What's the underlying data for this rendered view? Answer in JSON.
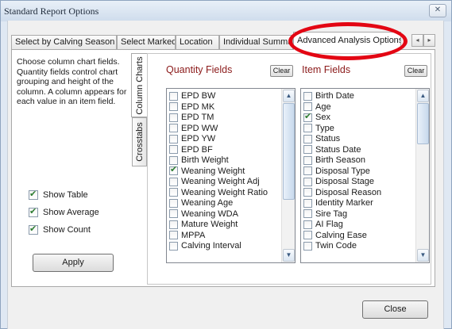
{
  "window": {
    "title": "Standard Report Options",
    "close_glyph": "✕"
  },
  "tabs": [
    {
      "label": "Select by Calving Season"
    },
    {
      "label": "Select Marked"
    },
    {
      "label": "Location"
    },
    {
      "label": "Individual Summary"
    },
    {
      "label": "Advanced Analysis Options",
      "active": true
    }
  ],
  "tab_scroll": {
    "left": "◂",
    "right": "▸"
  },
  "vertical_tabs": [
    {
      "label": "Column Charts",
      "active": true
    },
    {
      "label": "Crosstabs"
    }
  ],
  "description": "Choose column chart fields. Quantity fields control chart grouping and height of the column. A column appears for each value in an item field.",
  "options": [
    {
      "label": "Show Table",
      "checked": true
    },
    {
      "label": "Show Average",
      "checked": true
    },
    {
      "label": "Show Count",
      "checked": true
    }
  ],
  "apply_label": "Apply",
  "quantity_fields": {
    "title": "Quantity Fields",
    "clear_label": "Clear",
    "items": [
      {
        "label": "EPD BW",
        "checked": false
      },
      {
        "label": "EPD MK",
        "checked": false
      },
      {
        "label": "EPD TM",
        "checked": false
      },
      {
        "label": "EPD WW",
        "checked": false
      },
      {
        "label": "EPD YW",
        "checked": false
      },
      {
        "label": "EPD BF",
        "checked": false
      },
      {
        "label": "Birth Weight",
        "checked": false
      },
      {
        "label": "Weaning Weight",
        "checked": true
      },
      {
        "label": "Weaning Weight Adj",
        "checked": false
      },
      {
        "label": "Weaning Weight Ratio",
        "checked": false
      },
      {
        "label": "Weaning Age",
        "checked": false
      },
      {
        "label": "Weaning WDA",
        "checked": false
      },
      {
        "label": "Mature Weight",
        "checked": false
      },
      {
        "label": "MPPA",
        "checked": false
      },
      {
        "label": "Calving Interval",
        "checked": false
      }
    ]
  },
  "item_fields": {
    "title": "Item Fields",
    "clear_label": "Clear",
    "items": [
      {
        "label": "Birth Date",
        "checked": false
      },
      {
        "label": "Age",
        "checked": false
      },
      {
        "label": "Sex",
        "checked": true
      },
      {
        "label": "Type",
        "checked": false
      },
      {
        "label": "Status",
        "checked": false
      },
      {
        "label": "Status Date",
        "checked": false
      },
      {
        "label": "Birth Season",
        "checked": false
      },
      {
        "label": "Disposal Type",
        "checked": false
      },
      {
        "label": "Disposal Stage",
        "checked": false
      },
      {
        "label": "Disposal Reason",
        "checked": false
      },
      {
        "label": "Identity Marker",
        "checked": false
      },
      {
        "label": "Sire Tag",
        "checked": false
      },
      {
        "label": "AI Flag",
        "checked": false
      },
      {
        "label": "Calving Ease",
        "checked": false
      },
      {
        "label": "Twin Code",
        "checked": false
      }
    ]
  },
  "scroll_glyphs": {
    "up": "▲",
    "down": "▼"
  },
  "close_label": "Close",
  "colors": {
    "annotation_ring": "#e30613",
    "section_title": "#8b1a1a",
    "check_mark": "#2e7d32"
  }
}
